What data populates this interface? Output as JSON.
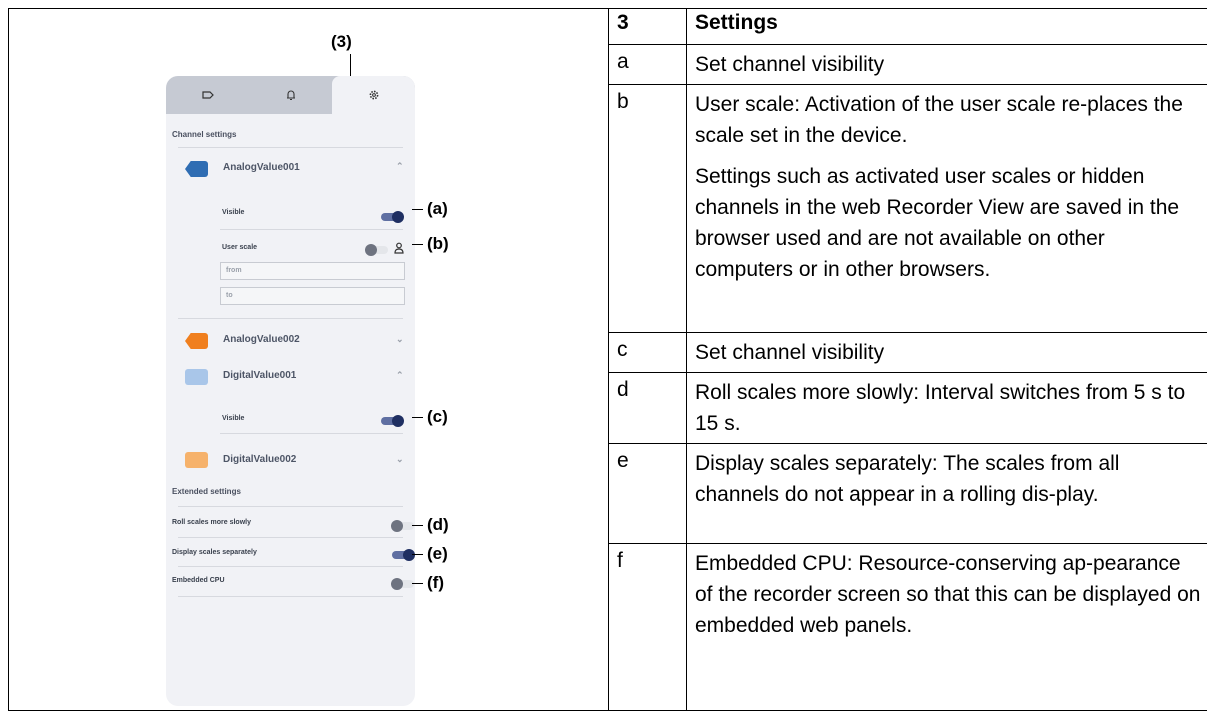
{
  "table": {
    "header": {
      "number": "3",
      "title": "Settings"
    },
    "rows": [
      {
        "letter": "a",
        "text": [
          "Set channel visibility"
        ]
      },
      {
        "letter": "b",
        "text": [
          "User scale: Activation of the user scale re-places the scale set in the device.",
          "Settings such as activated user scales or hidden channels in the web Recorder View are saved in the browser used and are not available on other computers or in other browsers."
        ]
      },
      {
        "letter": "c",
        "text": [
          "Set channel visibility"
        ]
      },
      {
        "letter": "d",
        "text": [
          "Roll scales more slowly: Interval switches from 5 s to 15 s."
        ]
      },
      {
        "letter": "e",
        "text": [
          "Display scales separately: The scales from all channels do not appear in a rolling dis-play."
        ]
      },
      {
        "letter": "f",
        "text": [
          "Embedded CPU: Resource-conserving ap-pearance of the recorder screen so that this can be displayed on embedded web panels."
        ]
      }
    ]
  },
  "figure": {
    "callouts": {
      "tab": "(3)",
      "a": "(a)",
      "b": "(b)",
      "c": "(c)",
      "d": "(d)",
      "e": "(e)",
      "f": "(f)"
    },
    "tabs": [
      {
        "icon": "channel-tag-icon"
      },
      {
        "icon": "bell-icon"
      },
      {
        "icon": "gear-icon",
        "active": true
      }
    ],
    "channel_settings_title": "Channel settings",
    "channels": [
      {
        "number": "1",
        "name": "AnalogValue001",
        "color": "#2f6db3",
        "expanded": true
      },
      {
        "number": "2",
        "name": "AnalogValue002",
        "color": "#f07f1e",
        "expanded": false
      },
      {
        "number": "1",
        "name": "DigitalValue001",
        "color": "#a9c6e9",
        "expanded": true
      },
      {
        "number": "2",
        "name": "DigitalValue002",
        "color": "#f6b26b",
        "expanded": false
      }
    ],
    "visible_label": "Visible",
    "user_scale_label": "User scale",
    "from_placeholder": "from",
    "to_placeholder": "to",
    "extended_settings_title": "Extended settings",
    "extended": [
      {
        "label": "Roll scales more slowly",
        "on": false
      },
      {
        "label": "Display scales separately",
        "on": true
      },
      {
        "label": "Embedded CPU",
        "on": false
      }
    ],
    "toggles": {
      "visible_a": true,
      "user_scale": false,
      "visible_c": true
    }
  }
}
